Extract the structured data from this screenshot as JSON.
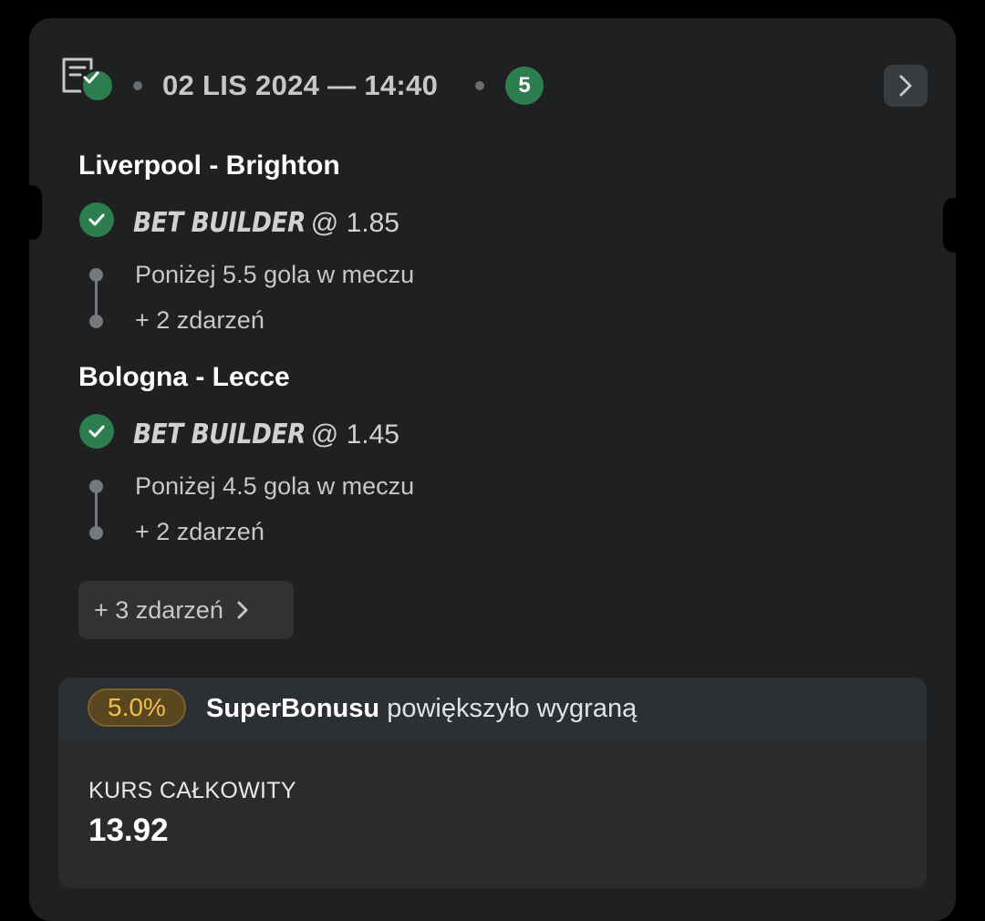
{
  "colors": {
    "background": "#000000",
    "card": "#1f2021",
    "success_green": "#2e7d4f",
    "bonus_gold": "#f0c04a",
    "muted_text": "#c5c7c9"
  },
  "header": {
    "icon": "ticket-won-icon",
    "datetime": "02 LIS 2024 — 14:40",
    "event_count": "5",
    "next_icon": "chevron-right-icon"
  },
  "events": [
    {
      "title": "Liverpool - Brighton",
      "status_icon": "check-icon",
      "bet_type": "BET BUILDER",
      "odds": "@ 1.85",
      "selection": "Poniżej 5.5 gola w meczu",
      "more": "+ 2 zdarzeń"
    },
    {
      "title": "Bologna - Lecce",
      "status_icon": "check-icon",
      "bet_type": "BET BUILDER",
      "odds": "@ 1.45",
      "selection": "Poniżej 4.5 gola w meczu",
      "more": "+ 2 zdarzeń"
    }
  ],
  "more_events_button": "+ 3 zdarzeń",
  "summary": {
    "bonus_percent": "5.0%",
    "bonus_brand": "SuperBonusu",
    "bonus_text": "powiększyło wygraną",
    "total_label": "KURS CAŁKOWITY",
    "total_value": "13.92"
  }
}
